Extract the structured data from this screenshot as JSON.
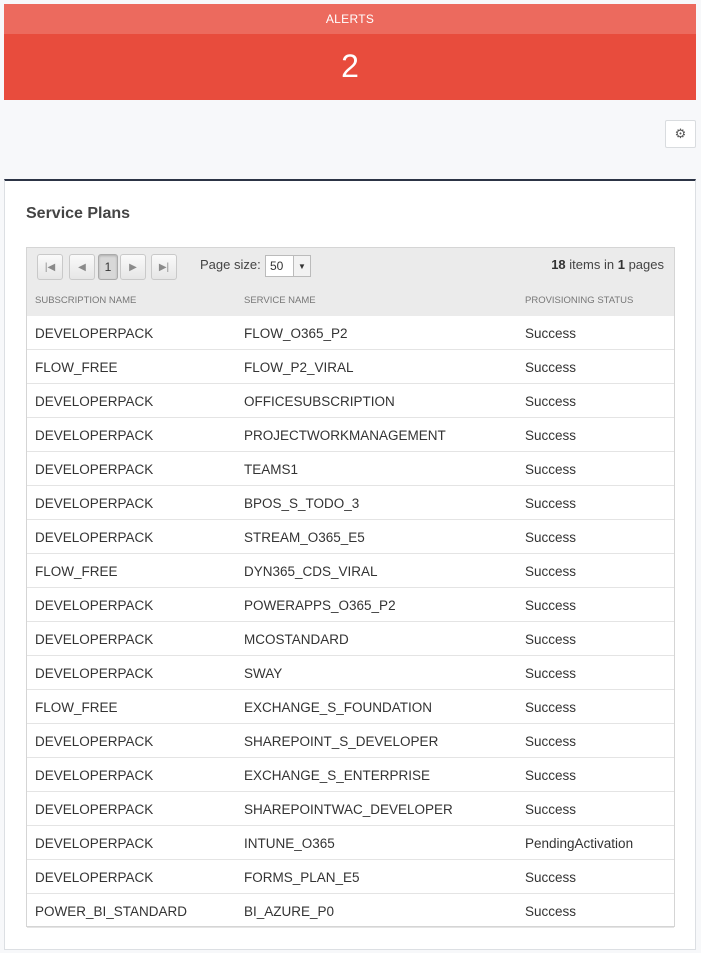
{
  "alerts": {
    "title": "ALERTS",
    "count": "2"
  },
  "settings": {
    "icon": "gear-icon"
  },
  "panel": {
    "title": "Service Plans"
  },
  "pager": {
    "current_page": "1",
    "page_size_label": "Page size:",
    "page_size": "50",
    "items_count": "18",
    "items_text": "items in",
    "pages_count": "1",
    "pages_text": "pages"
  },
  "columns": [
    "SUBSCRIPTION NAME",
    "SERVICE NAME",
    "PROVISIONING STATUS"
  ],
  "rows": [
    [
      "DEVELOPERPACK",
      "FLOW_O365_P2",
      "Success"
    ],
    [
      "FLOW_FREE",
      "FLOW_P2_VIRAL",
      "Success"
    ],
    [
      "DEVELOPERPACK",
      "OFFICESUBSCRIPTION",
      "Success"
    ],
    [
      "DEVELOPERPACK",
      "PROJECTWORKMANAGEMENT",
      "Success"
    ],
    [
      "DEVELOPERPACK",
      "TEAMS1",
      "Success"
    ],
    [
      "DEVELOPERPACK",
      "BPOS_S_TODO_3",
      "Success"
    ],
    [
      "DEVELOPERPACK",
      "STREAM_O365_E5",
      "Success"
    ],
    [
      "FLOW_FREE",
      "DYN365_CDS_VIRAL",
      "Success"
    ],
    [
      "DEVELOPERPACK",
      "POWERAPPS_O365_P2",
      "Success"
    ],
    [
      "DEVELOPERPACK",
      "MCOSTANDARD",
      "Success"
    ],
    [
      "DEVELOPERPACK",
      "SWAY",
      "Success"
    ],
    [
      "FLOW_FREE",
      "EXCHANGE_S_FOUNDATION",
      "Success"
    ],
    [
      "DEVELOPERPACK",
      "SHAREPOINT_S_DEVELOPER",
      "Success"
    ],
    [
      "DEVELOPERPACK",
      "EXCHANGE_S_ENTERPRISE",
      "Success"
    ],
    [
      "DEVELOPERPACK",
      "SHAREPOINTWAC_DEVELOPER",
      "Success"
    ],
    [
      "DEVELOPERPACK",
      "INTUNE_O365",
      "PendingActivation"
    ],
    [
      "DEVELOPERPACK",
      "FORMS_PLAN_E5",
      "Success"
    ],
    [
      "POWER_BI_STANDARD",
      "BI_AZURE_P0",
      "Success"
    ]
  ]
}
